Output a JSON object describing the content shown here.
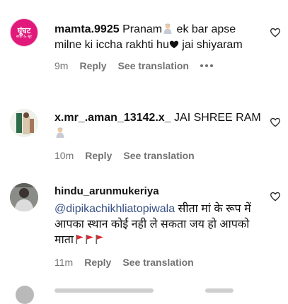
{
  "colors": {
    "text": "#111111",
    "muted": "#737373",
    "mention": "#385185",
    "flag": "#e3262f"
  },
  "comments": [
    {
      "username": "mamta.9925",
      "text_before": "Pranam",
      "text_after": " ek bar apse milne ki iccha rakhti hu",
      "text_end": " jai shiyaram",
      "time": "9m",
      "reply": "Reply",
      "see_translation": "See translation",
      "more_icon": "more-horizontal-icon",
      "like_icon": "heart-outline-icon",
      "avatar_logo": "घूंघट",
      "avatar_logo_sub": "साड़ी & सूट"
    },
    {
      "username": "x.mr_.aman_13142.x_",
      "text_before": "JAI SHREE RAM",
      "time": "10m",
      "reply": "Reply",
      "see_translation": "See translation",
      "like_icon": "heart-outline-icon"
    },
    {
      "username": "hindu_arunmukeriya",
      "mention": "@dipikachikhliatopiwala",
      "text": " सीता मां के रूप में आपका स्थान कोई नही ले सकता जय हो आपको माता",
      "time": "11m",
      "reply": "Reply",
      "see_translation": "See translation",
      "like_icon": "heart-outline-icon"
    }
  ]
}
